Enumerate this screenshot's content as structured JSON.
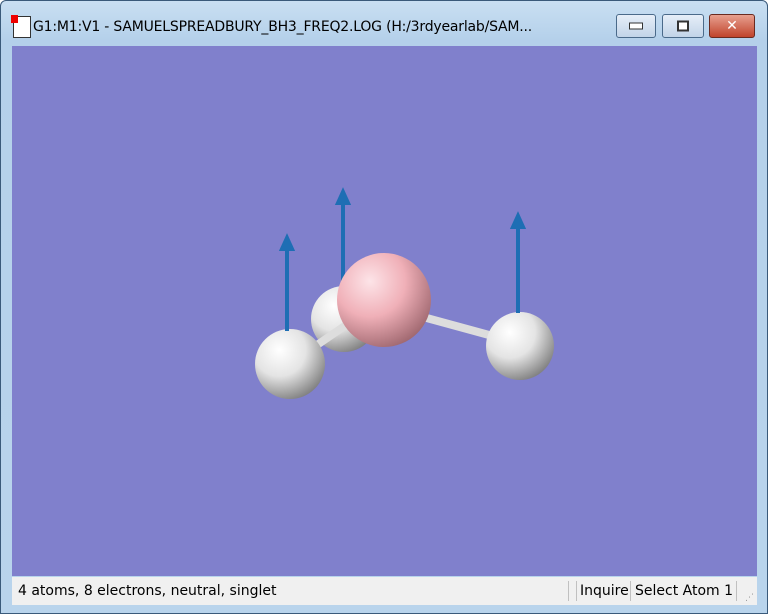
{
  "window": {
    "title": "G1:M1:V1 - SAMUELSPREADBURY_BH3_FREQ2.LOG (H:/3rdyearlab/SAM..."
  },
  "colors": {
    "background": "#8080cc",
    "boron": "#f0b0b8",
    "hydrogen": "#ffffff",
    "vector": "#1e6eb4"
  },
  "status": {
    "info": "4 atoms, 8 electrons, neutral, singlet",
    "mode": "Inquire",
    "action": "Select Atom 1"
  }
}
